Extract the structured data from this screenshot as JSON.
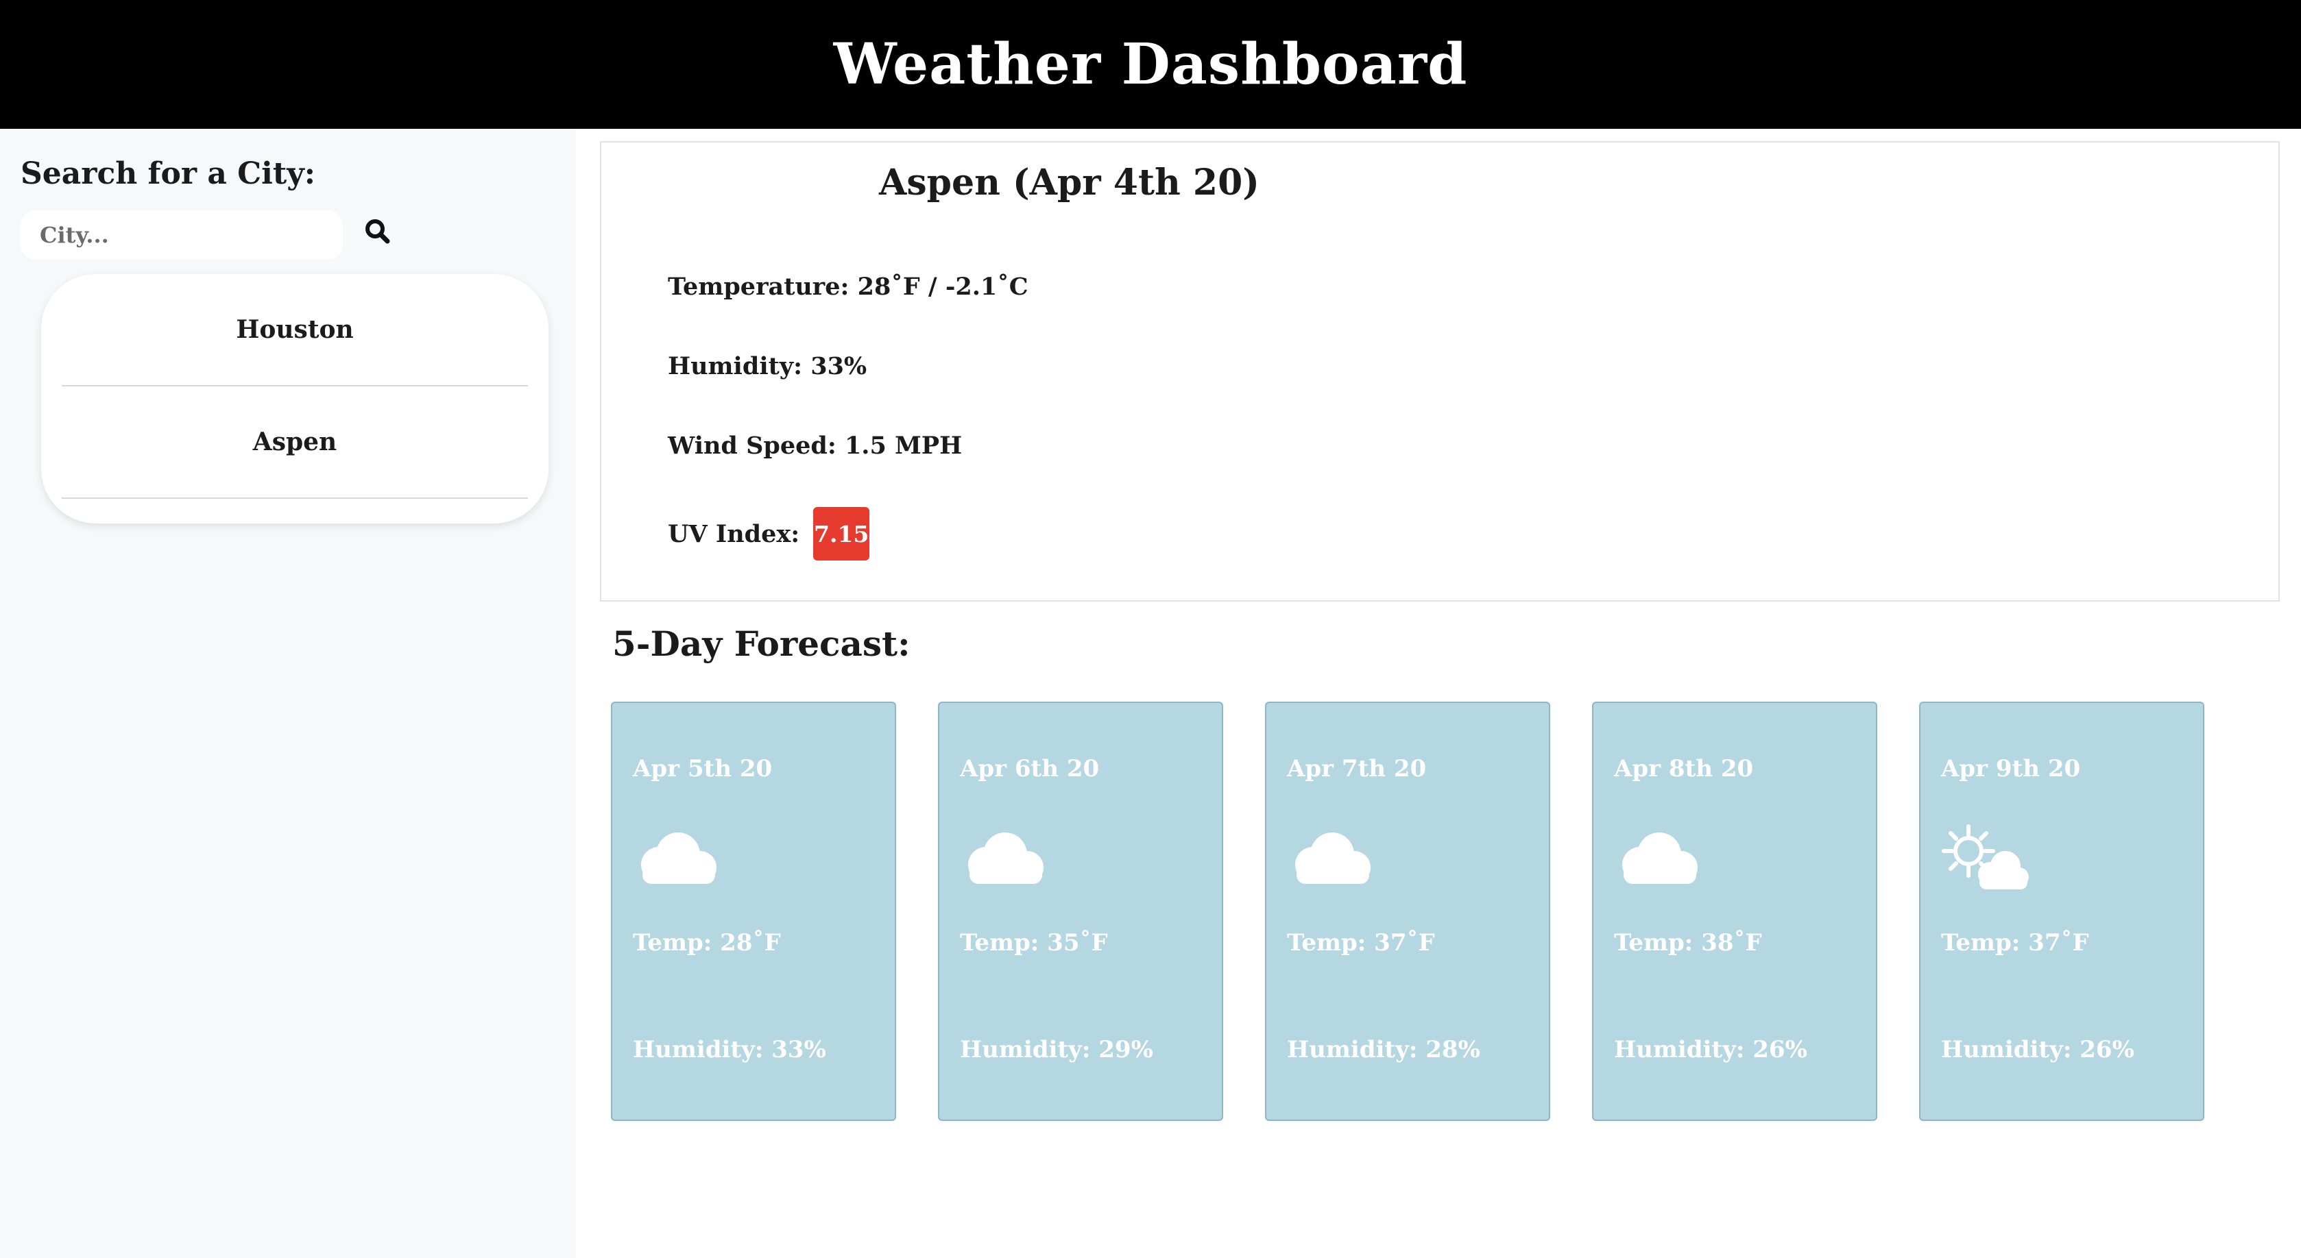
{
  "header": {
    "title": "Weather Dashboard"
  },
  "sidebar": {
    "title": "Search for a City:",
    "search": {
      "placeholder": "City...",
      "value": ""
    },
    "history": [
      "Houston",
      "Aspen"
    ]
  },
  "current": {
    "title": "Aspen (Apr 4th 20)",
    "temperature": "Temperature: 28˚F / -2.1˚C",
    "humidity": "Humidity: 33%",
    "wind": "Wind Speed: 1.5 MPH",
    "uv_label": "UV Index:",
    "uv_value": "7.15",
    "uv_color": "#e53a2d"
  },
  "forecast": {
    "title": "5-Day Forecast:",
    "days": [
      {
        "date": "Apr 5th 20",
        "icon": "cloud-icon",
        "temp": "Temp: 28˚F",
        "humidity": "Humidity: 33%"
      },
      {
        "date": "Apr 6th 20",
        "icon": "cloud-icon",
        "temp": "Temp: 35˚F",
        "humidity": "Humidity: 29%"
      },
      {
        "date": "Apr 7th 20",
        "icon": "cloud-icon",
        "temp": "Temp: 37˚F",
        "humidity": "Humidity: 28%"
      },
      {
        "date": "Apr 8th 20",
        "icon": "cloud-icon",
        "temp": "Temp: 38˚F",
        "humidity": "Humidity: 26%"
      },
      {
        "date": "Apr 9th 20",
        "icon": "partly-cloudy-icon",
        "temp": "Temp: 37˚F",
        "humidity": "Humidity: 26%"
      }
    ]
  },
  "colors": {
    "header_bg": "#000000",
    "card_bg": "#b5d7e2",
    "sidebar_bg": "#f7f8fa"
  }
}
